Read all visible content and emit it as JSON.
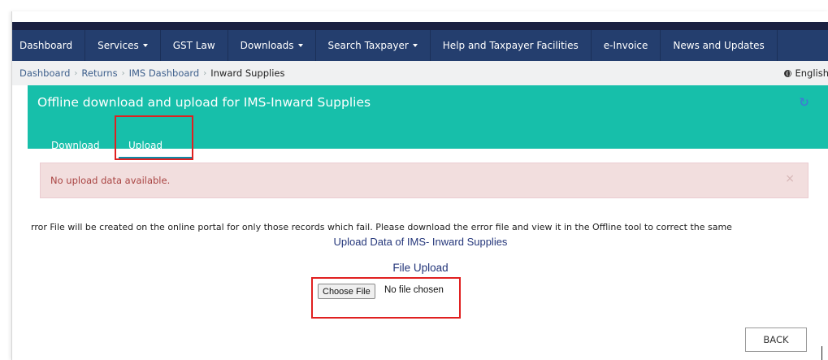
{
  "nav": {
    "items": [
      {
        "label": "Dashboard",
        "dropdown": false
      },
      {
        "label": "Services",
        "dropdown": true
      },
      {
        "label": "GST Law",
        "dropdown": false
      },
      {
        "label": "Downloads",
        "dropdown": true
      },
      {
        "label": "Search Taxpayer",
        "dropdown": true
      },
      {
        "label": "Help and Taxpayer Facilities",
        "dropdown": false
      },
      {
        "label": "e-Invoice",
        "dropdown": false
      },
      {
        "label": "News and Updates",
        "dropdown": false
      }
    ]
  },
  "breadcrumb": {
    "items": [
      "Dashboard",
      "Returns",
      "IMS Dashboard"
    ],
    "current": "Inward Supplies",
    "language": "English"
  },
  "panel": {
    "title": "Offline download and upload for IMS-Inward Supplies",
    "tabs": [
      "Download",
      "Upload"
    ],
    "active_tab": "Upload"
  },
  "alert": {
    "message": "No upload data available.",
    "close": "×"
  },
  "info_text": "rror File will be created on the online portal for only those records which fail. Please download the error file and view it in the Offline tool to correct the same",
  "upload": {
    "title": "Upload Data of IMS- Inward Supplies",
    "file_label": "File Upload",
    "choose_button": "Choose File",
    "no_file": "No file chosen"
  },
  "back_button": "BACK",
  "colors": {
    "navbar": "#243e6e",
    "panel": "#17bfaa",
    "alert_bg": "#f2dede",
    "alert_text": "#a94442",
    "highlight": "#e02020"
  }
}
